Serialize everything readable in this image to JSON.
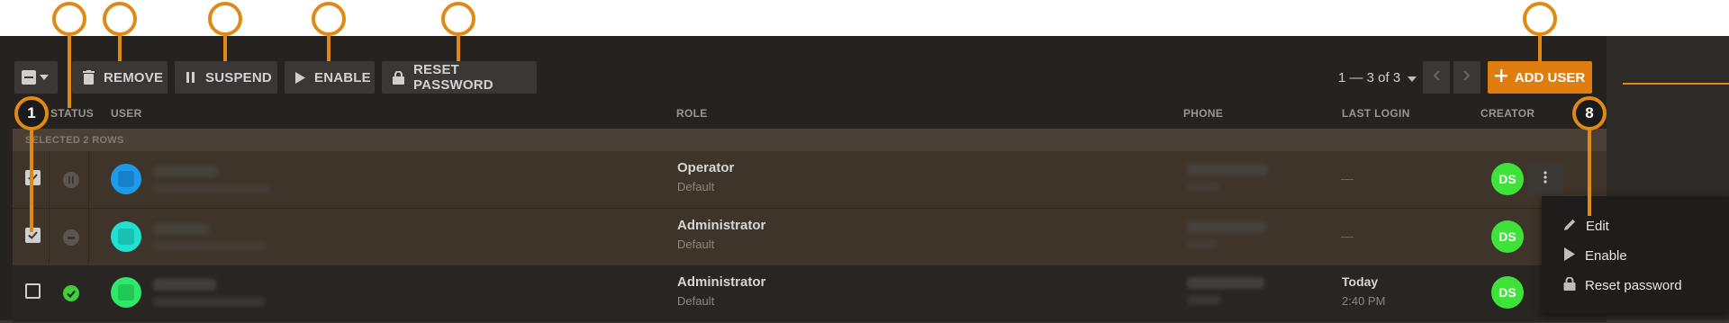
{
  "toolbar": {
    "remove_label": "REMOVE",
    "suspend_label": "SUSPEND",
    "enable_label": "ENABLE",
    "reset_password_label": "RESET PASSWORD",
    "add_user_label": "ADD USER"
  },
  "pagination": {
    "range": "1 — 3 of 3"
  },
  "columns": {
    "status": "STATUS",
    "user": "USER",
    "role": "ROLE",
    "phone": "PHONE",
    "last_login": "LAST LOGIN",
    "creator": "CREATOR"
  },
  "selection": {
    "text": "SELECTED 2 ROWS"
  },
  "rows": [
    {
      "selected": true,
      "status": "suspended",
      "role": "Operator",
      "role_sub": "Default",
      "last_login": "—",
      "last_login_time": "",
      "creator": "DS",
      "avatar_color": "#1e9be8"
    },
    {
      "selected": true,
      "status": "disabled",
      "role": "Administrator",
      "role_sub": "Default",
      "last_login": "—",
      "last_login_time": "",
      "creator": "DS",
      "avatar_color": "#22e0d0"
    },
    {
      "selected": false,
      "status": "active",
      "role": "Administrator",
      "role_sub": "Default",
      "last_login": "Today",
      "last_login_time": "2:40 PM",
      "creator": "DS",
      "avatar_color": "#2ee86a"
    }
  ],
  "context_menu": {
    "items": [
      {
        "label": "Edit",
        "icon": "pencil-icon"
      },
      {
        "label": "Enable",
        "icon": "play-icon"
      },
      {
        "label": "Reset password",
        "icon": "lock-icon"
      }
    ]
  },
  "annotations": {
    "badge_1": "1",
    "badge_8": "8"
  },
  "colors": {
    "accent": "#e07d10",
    "annotation": "#e08a14",
    "active": "#3ecf3a",
    "creator": "#3ee33a"
  }
}
